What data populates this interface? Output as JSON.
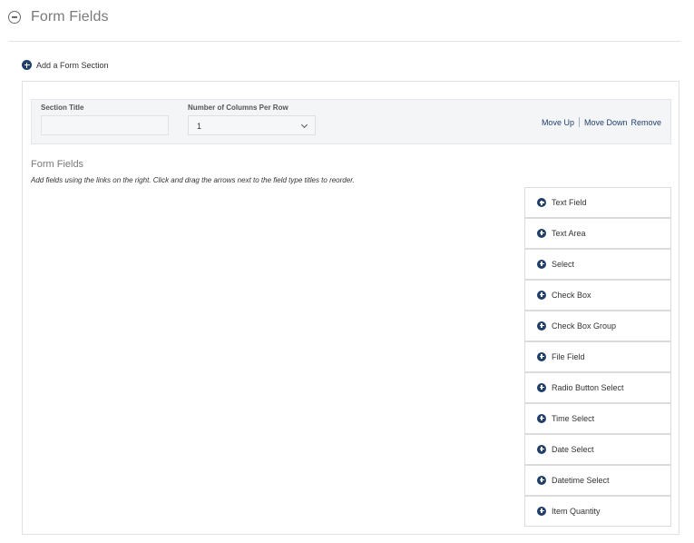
{
  "header": {
    "title": "Form Fields",
    "collapse_icon": "minus-circle-icon"
  },
  "add_section": {
    "label": "Add a Form Section",
    "icon": "plus-circle-icon"
  },
  "section": {
    "title_label": "Section Title",
    "title_value": "",
    "columns_label": "Number of Columns Per Row",
    "columns_value": "1",
    "actions": {
      "move_up": "Move Up",
      "move_down": "Move Down",
      "remove": "Remove"
    }
  },
  "form_fields": {
    "heading": "Form Fields",
    "help_text": "Add fields using the links on the right. Click and drag the arrows next to the field type titles to reorder.",
    "field_types": [
      {
        "label": "Text Field"
      },
      {
        "label": "Text Area"
      },
      {
        "label": "Select"
      },
      {
        "label": "Check Box"
      },
      {
        "label": "Check Box Group"
      },
      {
        "label": "File Field"
      },
      {
        "label": "Radio Button Select"
      },
      {
        "label": "Time Select"
      },
      {
        "label": "Date Select"
      },
      {
        "label": "Datetime Select"
      },
      {
        "label": "Item Quantity"
      }
    ]
  },
  "colors": {
    "accent": "#1f3f6a",
    "muted_text": "#7a7a7a",
    "panel_bg": "#f4f5f7",
    "border": "#dcdcdc"
  }
}
